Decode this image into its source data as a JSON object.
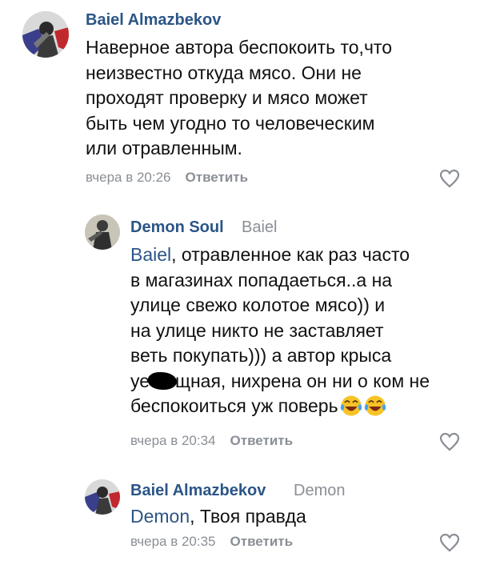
{
  "comments": [
    {
      "author": "Baiel Almazbekov",
      "reply_to": "",
      "mention": "",
      "lines": [
        "Наверное автора беспокоить то,что",
        "неизвестно откуда  мясо. Они не",
        "проходят проверку и мясо может",
        "быть чем угодно то человеческим",
        "или отравленным."
      ],
      "time": "вчера в 20:26",
      "reply_label": "Ответить",
      "like_icon": "heart-outline-icon"
    },
    {
      "author": "Demon Soul",
      "reply_to": "Baiel",
      "mention": "Baiel",
      "lines": [
        ", отравленное как раз часто",
        "в магазинах попадаеться..а на",
        "улице свежо колотое мясо)) и",
        "на улице никто не заставляет",
        "веть покупать))) а автор крыса",
        "щная, нихрена он ни о ком не",
        "беспокоиться уж поверь"
      ],
      "censored_prefix": "уе",
      "emoji": "tears-of-joy-emoji",
      "time": "вчера в 20:34",
      "reply_label": "Ответить",
      "like_icon": "heart-outline-icon"
    },
    {
      "author": "Baiel Almazbekov",
      "reply_to": "Demon",
      "mention": "Demon",
      "lines": [
        ", Твоя правда"
      ],
      "time": "вчера в 20:35",
      "reply_label": "Ответить",
      "like_icon": "heart-outline-icon"
    }
  ],
  "colors": {
    "link": "#2b5587",
    "meta": "#8a8f96",
    "text": "#111111"
  }
}
